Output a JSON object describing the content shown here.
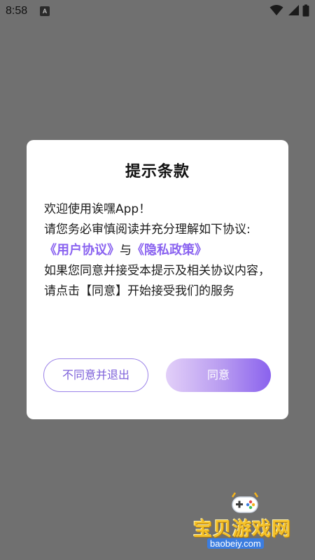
{
  "status_bar": {
    "time": "8:58",
    "notification_letter": "A",
    "icons": [
      "a-icon",
      "wifi-icon",
      "signal-icon",
      "battery-icon"
    ]
  },
  "dialog": {
    "title": "提示条款",
    "line1": "欢迎使用诶嘿App！",
    "line2": "请您务必审慎阅读并充分理解如下协议:",
    "user_agreement": "《用户协议》",
    "connector": "与",
    "privacy_policy": "《隐私政策》",
    "line4": "如果您同意并接受本提示及相关协议内容，请点击【同意】开始接受我们的服务",
    "decline_label": "不同意并退出",
    "agree_label": "同意"
  },
  "watermark": {
    "text": "宝贝游戏网",
    "domain": "baobeiy.com"
  },
  "colors": {
    "overlay": "#707070",
    "accent": "#8a63f0",
    "button_gradient_start": "#e2cff8",
    "button_gradient_end": "#8a62ee"
  }
}
